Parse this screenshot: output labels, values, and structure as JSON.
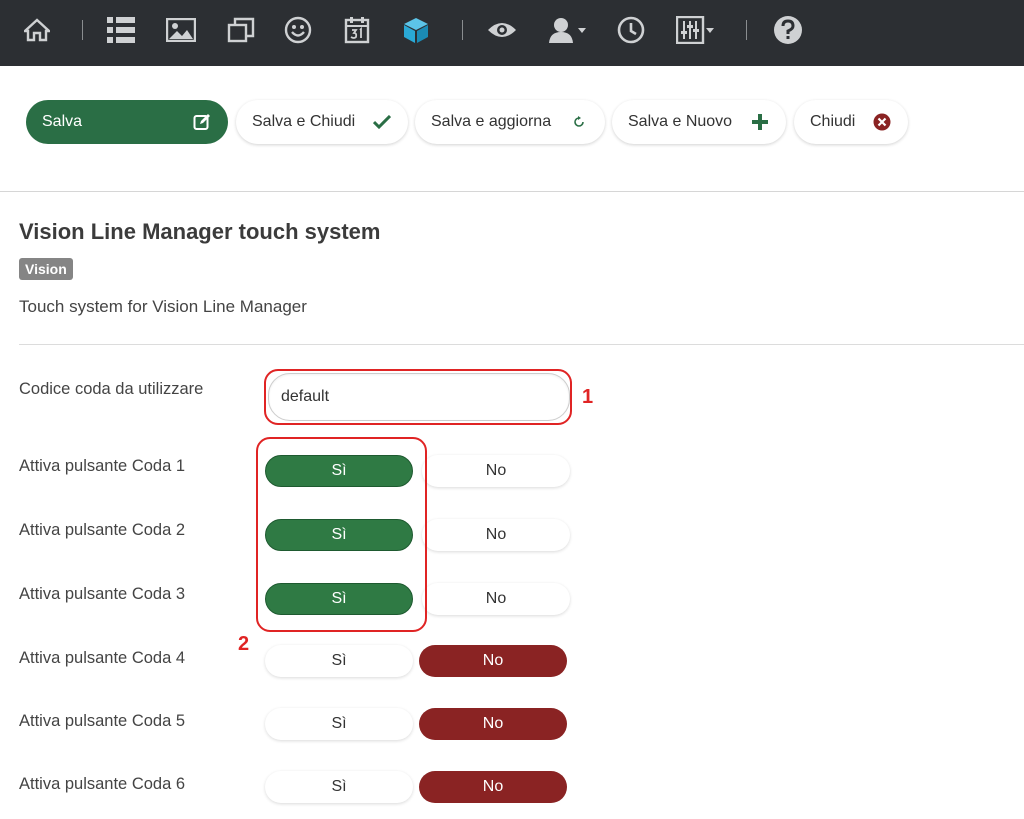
{
  "toolbar": {
    "save": "Salva",
    "save_close": "Salva e Chiudi",
    "save_refresh": "Salva e aggiorna",
    "save_new": "Salva e Nuovo",
    "close": "Chiudi"
  },
  "header": {
    "title": "Vision Line Manager touch system",
    "badge": "Vision",
    "description": "Touch system for Vision Line Manager"
  },
  "form": {
    "queue_code": {
      "label": "Codice coda da utilizzare",
      "value": "default"
    },
    "yes_label": "Sì",
    "no_label": "No",
    "queues": [
      {
        "label": "Attiva pulsante Coda 1",
        "selected": "Sì"
      },
      {
        "label": "Attiva pulsante Coda 2",
        "selected": "Sì"
      },
      {
        "label": "Attiva pulsante Coda 3",
        "selected": "Sì"
      },
      {
        "label": "Attiva pulsante Coda 4",
        "selected": "No"
      },
      {
        "label": "Attiva pulsante Coda 5",
        "selected": "No"
      },
      {
        "label": "Attiva pulsante Coda 6",
        "selected": "No"
      }
    ]
  },
  "annotations": {
    "one": "1",
    "two": "2"
  },
  "colors": {
    "accent_green": "#2a6e45",
    "accent_red": "#8a2323",
    "annotation_red": "#e02424",
    "nav_bg": "#2c2f33"
  },
  "icons": [
    "home-icon",
    "list-icon",
    "image-icon",
    "copy-icon",
    "smiley-icon",
    "calendar-icon",
    "cube-icon",
    "eye-icon",
    "user-icon",
    "clock-icon",
    "sliders-icon",
    "help-icon"
  ]
}
